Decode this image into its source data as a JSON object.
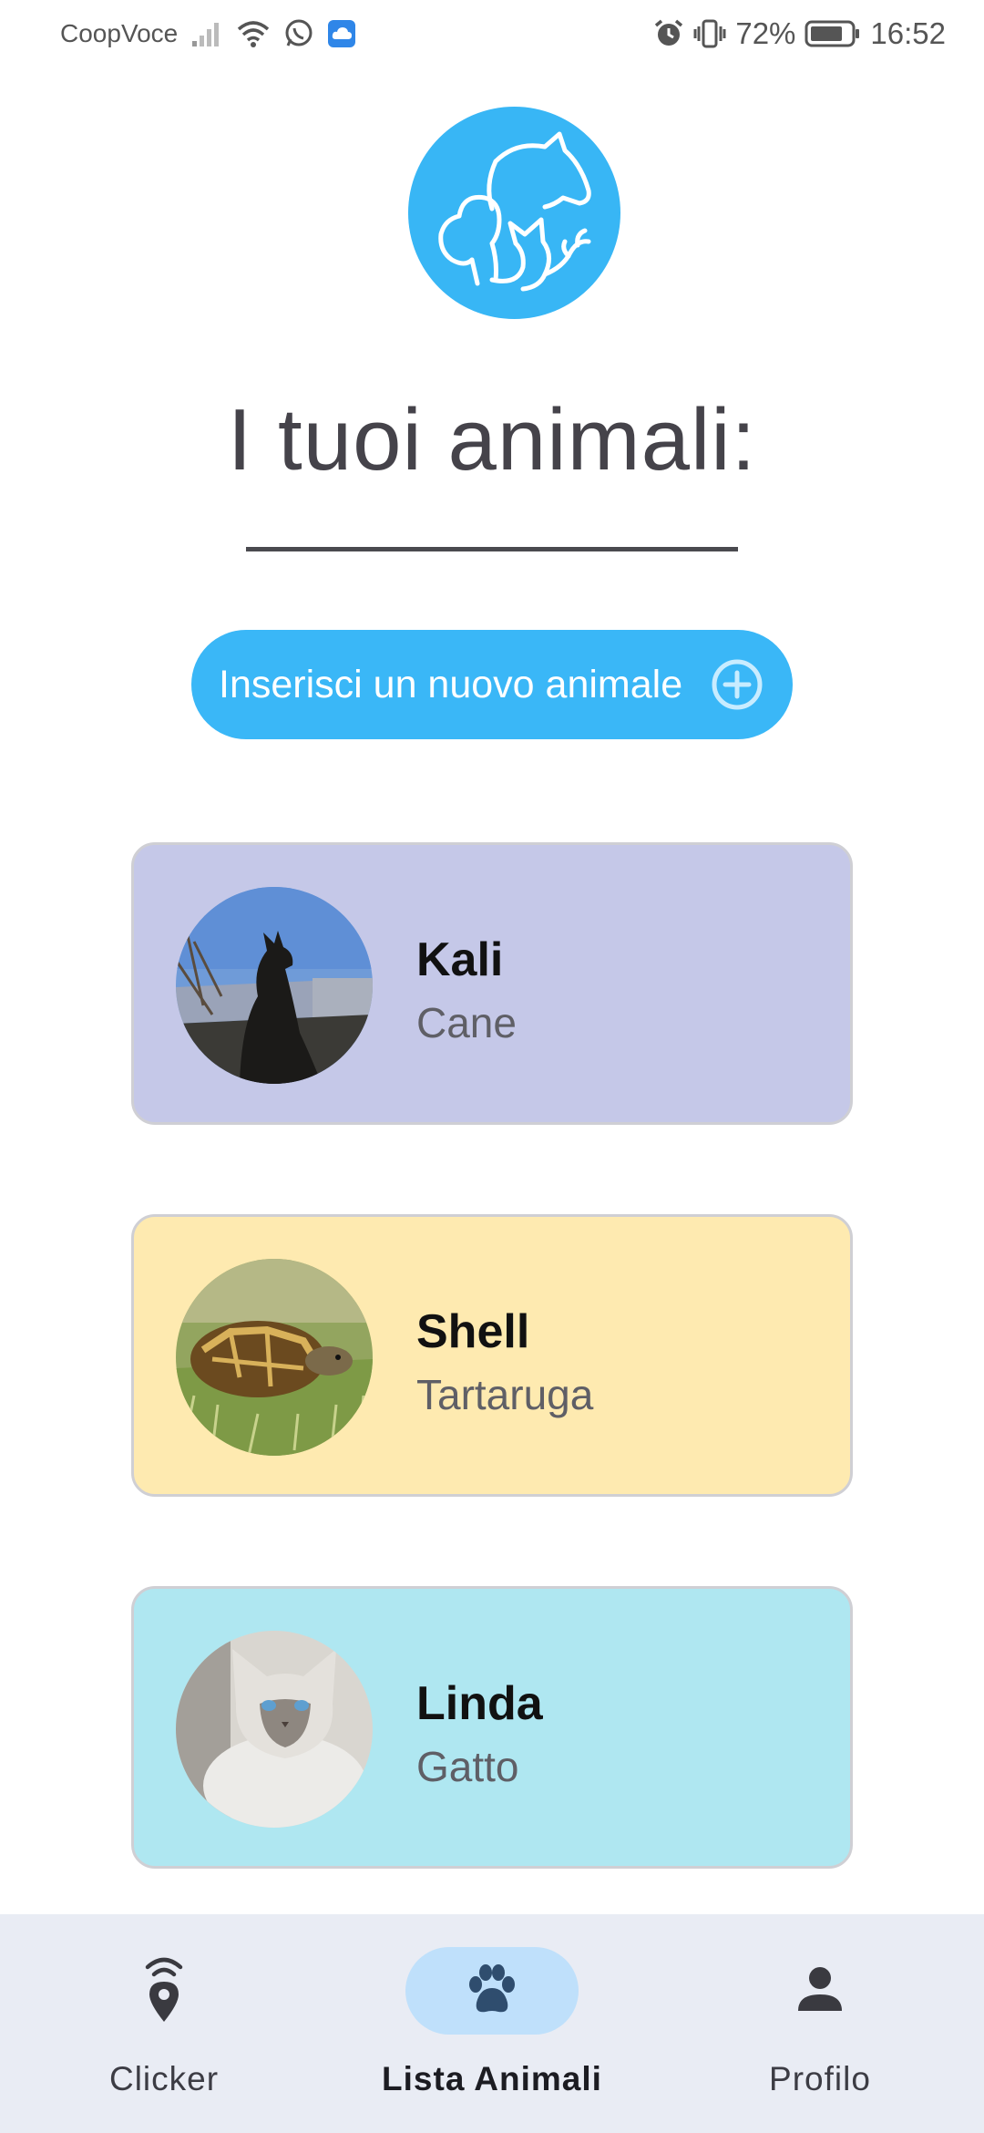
{
  "status_bar": {
    "carrier": "CoopVoce",
    "battery": "72%",
    "time": "16:52",
    "icons": [
      "signal-icon",
      "wifi-icon",
      "whatsapp-icon",
      "cloud-icon",
      "alarm-icon",
      "vibrate-icon",
      "battery-icon"
    ]
  },
  "header": {
    "logo_icon": "pets-logo-icon",
    "title": "I tuoi animali:"
  },
  "add_button": {
    "label": "Inserisci un nuovo animale",
    "icon": "plus-circle-icon"
  },
  "pets": [
    {
      "name": "Kali",
      "species": "Cane",
      "card_color": "#c5c8e8",
      "photo": "dog-photo"
    },
    {
      "name": "Shell",
      "species": "Tartaruga",
      "card_color": "#feeab0",
      "photo": "tortoise-photo"
    },
    {
      "name": "Linda",
      "species": "Gatto",
      "card_color": "#afe7f1",
      "photo": "cat-photo"
    }
  ],
  "bottom_nav": {
    "items": [
      {
        "label": "Clicker",
        "icon": "location-signal-icon",
        "active": false
      },
      {
        "label": "Lista Animali",
        "icon": "paw-icon",
        "active": true
      },
      {
        "label": "Profilo",
        "icon": "person-icon",
        "active": false
      }
    ]
  },
  "colors": {
    "accent": "#3ab7f7",
    "nav_background": "#e9ecf4",
    "nav_active_pill": "#bfe0fb"
  }
}
